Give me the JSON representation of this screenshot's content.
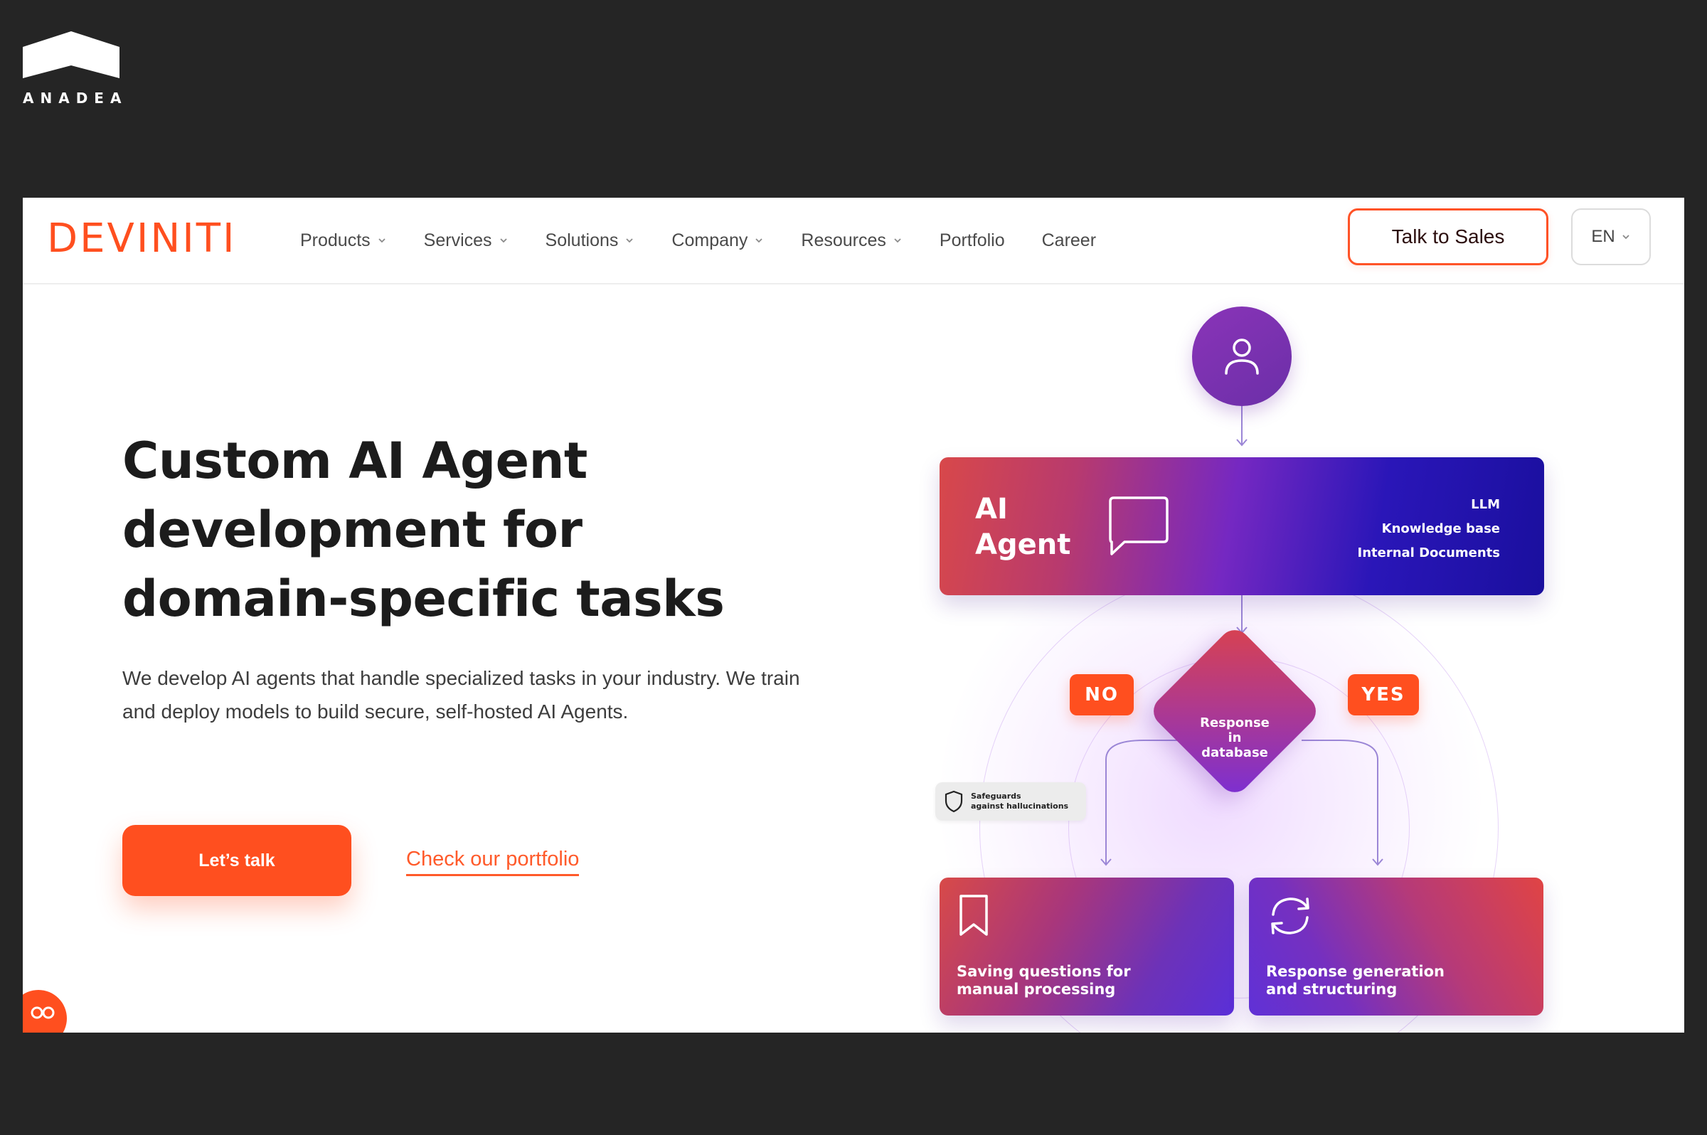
{
  "outer_brand": {
    "name": "ANADEA"
  },
  "site": {
    "brand": "DEVINITI",
    "nav": {
      "items": [
        {
          "label": "Products",
          "has_dropdown": true
        },
        {
          "label": "Services",
          "has_dropdown": true
        },
        {
          "label": "Solutions",
          "has_dropdown": true
        },
        {
          "label": "Company",
          "has_dropdown": true
        },
        {
          "label": "Resources",
          "has_dropdown": true
        },
        {
          "label": "Portfolio",
          "has_dropdown": false
        },
        {
          "label": "Career",
          "has_dropdown": false
        }
      ],
      "cta_label": "Talk to Sales",
      "language": "EN"
    }
  },
  "hero": {
    "title_lines": [
      "Custom AI Agent",
      "development for",
      "domain-specific tasks"
    ],
    "description": "We develop AI agents that handle specialized tasks in your industry. We train and deploy models to build secure, self-hosted AI Agents.",
    "primary_cta": "Let’s talk",
    "secondary_cta": "Check our portfolio"
  },
  "diagram": {
    "agent_title_lines": [
      "AI",
      "Agent"
    ],
    "agent_sources": [
      "LLM",
      "Knowledge base",
      "Internal Documents"
    ],
    "decision_lines": [
      "Response",
      "in",
      "database"
    ],
    "no_label": "NO",
    "yes_label": "YES",
    "safeguard_lines": [
      "Safeguards",
      "against hallucinations"
    ],
    "result_no_lines": [
      "Saving questions for",
      "manual processing"
    ],
    "result_yes_lines": [
      "Response generation",
      "and structuring"
    ]
  },
  "colors": {
    "background": "#252525",
    "accent": "#ff4f1f",
    "text_dark": "#1c1c1c",
    "text_body": "#3d3d3d",
    "purple": "#7a2fd4",
    "indigo": "#1a0f9e"
  },
  "icons": [
    "anadea-logo-icon",
    "chevron-down-icon",
    "user-icon",
    "chat-bubble-icon",
    "shield-icon",
    "bookmark-icon",
    "refresh-icon",
    "chat-widget-icon"
  ]
}
